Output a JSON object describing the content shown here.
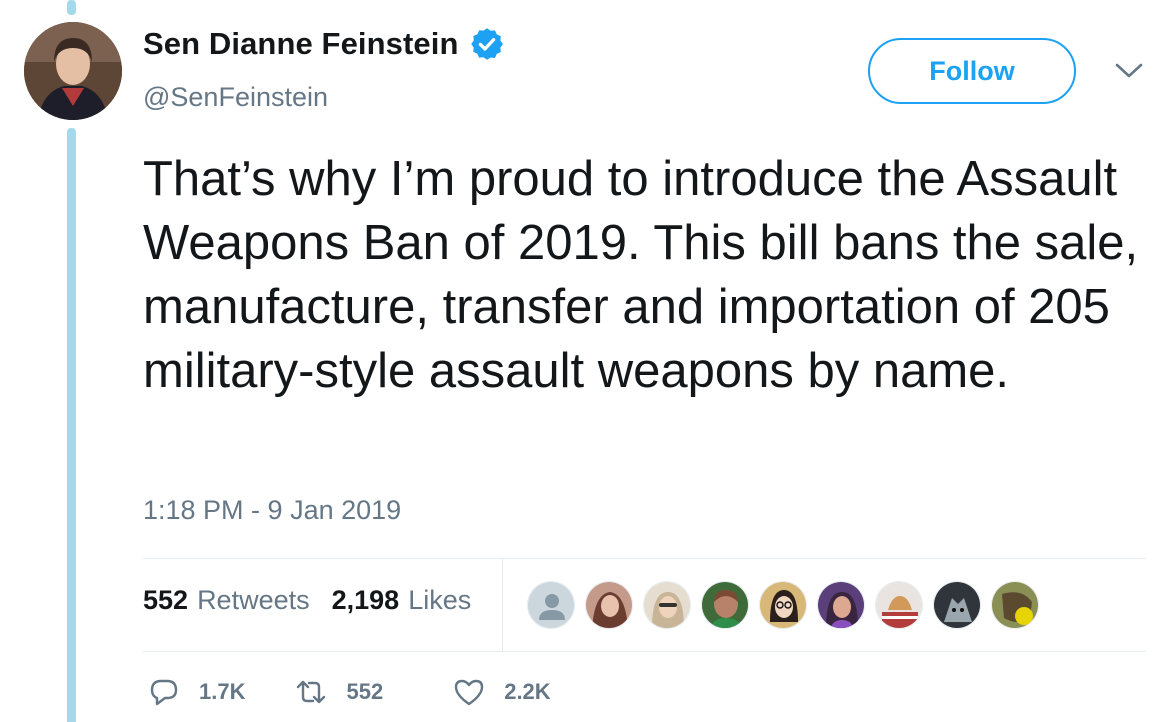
{
  "author": {
    "display_name": "Sen Dianne Feinstein",
    "handle": "@SenFeinstein",
    "verified_icon": "verified-badge-icon",
    "avatar_icon": "profile-photo"
  },
  "header": {
    "follow_label": "Follow",
    "menu_icon": "chevron-down-icon"
  },
  "tweet": {
    "text": "That’s why I’m proud to introduce the Assault Weapons Ban of 2019. This bill bans the sale, manufacture, transfer and importation of 205 military-style assault weapons by name.",
    "timestamp": "1:18 PM - 9 Jan 2019"
  },
  "stats": {
    "retweets_count": "552",
    "retweets_label": "Retweets",
    "likes_count": "2,198",
    "likes_label": "Likes"
  },
  "likers": [
    {
      "icon": "default-avatar",
      "bg": "#aab8c2"
    },
    {
      "icon": "avatar-photo",
      "bg": "#c49a8a"
    },
    {
      "icon": "avatar-photo",
      "bg": "#d8c9b5"
    },
    {
      "icon": "avatar-photo",
      "bg": "#7a4a35"
    },
    {
      "icon": "avatar-photo",
      "bg": "#c9a66b"
    },
    {
      "icon": "avatar-photo",
      "bg": "#5a3f7a"
    },
    {
      "icon": "avatar-photo",
      "bg": "#b33c3c"
    },
    {
      "icon": "avatar-photo",
      "bg": "#4a5560"
    },
    {
      "icon": "avatar-photo",
      "bg": "#c8b400"
    }
  ],
  "actions": {
    "reply_count": "1.7K",
    "retweet_count": "552",
    "like_count": "2.2K"
  },
  "colors": {
    "accent": "#1da1f2",
    "thread_line": "#a3d9ea",
    "secondary_text": "#657786",
    "primary_text": "#14171a"
  }
}
